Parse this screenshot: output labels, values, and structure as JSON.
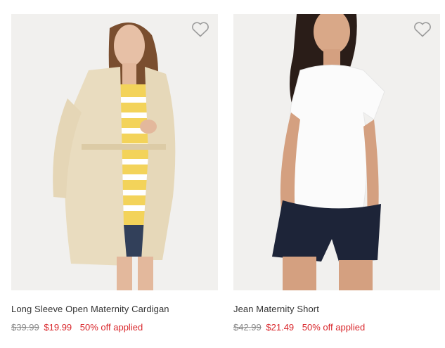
{
  "colors": {
    "sale": "#d9262b",
    "original": "#8a8a8a",
    "name": "#333333",
    "image_bg": "#f0efee"
  },
  "products": [
    {
      "name": "Long Sleeve Open Maternity Cardigan",
      "original_price": "$39.99",
      "sale_price": "$19.99",
      "promo": "50% off applied",
      "image": "woman-in-beige-cardigan-photo",
      "wishlist_icon": "heart-outline-icon"
    },
    {
      "name": "Jean Maternity Short",
      "original_price": "$42.99",
      "sale_price": "$21.49",
      "promo": "50% off applied",
      "image": "woman-in-white-tee-and-navy-shorts-photo",
      "wishlist_icon": "heart-outline-icon"
    }
  ]
}
